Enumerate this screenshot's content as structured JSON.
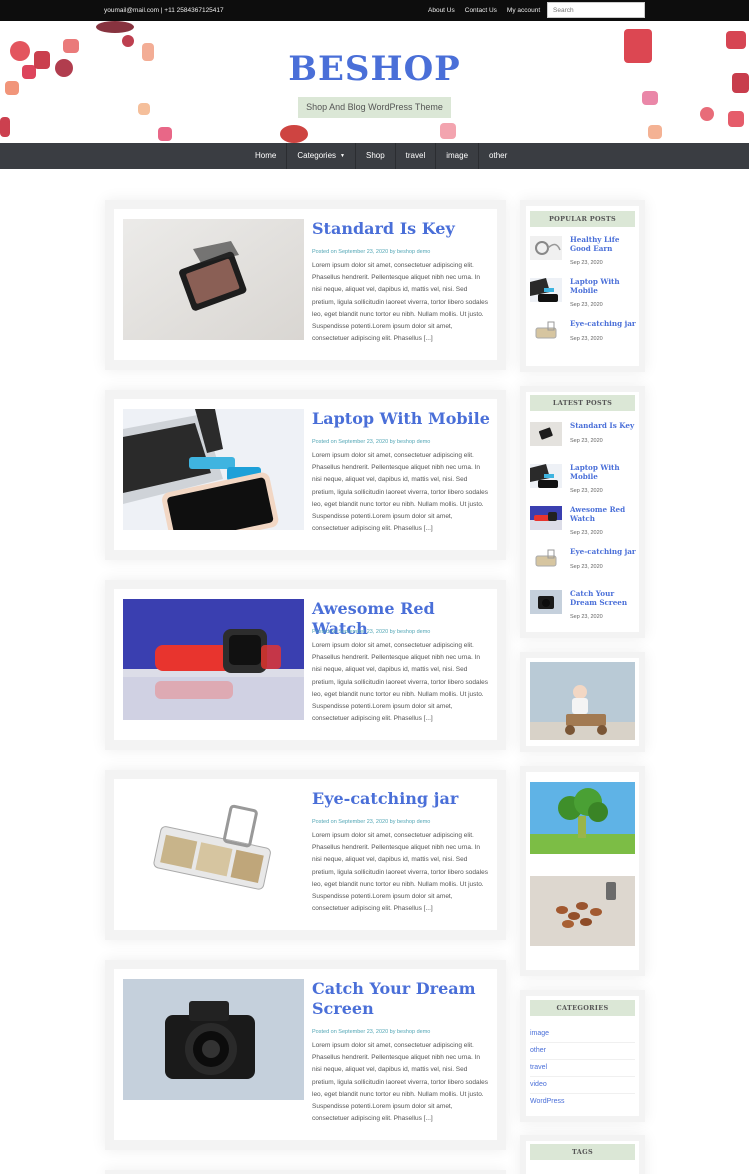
{
  "topbar": {
    "contact": "youmail@mail.com | +11 2584367125417",
    "links": [
      "About Us",
      "Contact Us",
      "My account"
    ],
    "search_placeholder": "Search"
  },
  "header": {
    "site_title": "BESHOP",
    "tagline": "Shop And Blog WordPress Theme"
  },
  "nav": {
    "items": [
      "Home",
      "Categories",
      "Shop",
      "travel",
      "image",
      "other"
    ]
  },
  "posts": [
    {
      "title": "Standard Is Key",
      "meta": "Posted on September 23, 2020 by beshop demo",
      "excerpt": "Lorem ipsum dolor sit amet, consectetuer adipiscing elit. Phasellus hendrerit. Pellentesque aliquet nibh nec urna. In nisi neque, aliquet vel, dapibus id, mattis vel, nisi. Sed pretium, ligula sollicitudin laoreet viverra, tortor libero sodales leo, eget blandit nunc tortor eu nibh. Nullam mollis. Ut justo. Suspendisse potenti.Lorem ipsum dolor sit amet, consectetuer adipiscing elit. Phasellus [...]"
    },
    {
      "title": "Laptop With Mobile",
      "meta": "Posted on September 23, 2020 by beshop demo",
      "excerpt": "Lorem ipsum dolor sit amet, consectetuer adipiscing elit. Phasellus hendrerit. Pellentesque aliquet nibh nec urna. In nisi neque, aliquet vel, dapibus id, mattis vel, nisi. Sed pretium, ligula sollicitudin laoreet viverra, tortor libero sodales leo, eget blandit nunc tortor eu nibh. Nullam mollis. Ut justo. Suspendisse potenti.Lorem ipsum dolor sit amet, consectetuer adipiscing elit. Phasellus [...]"
    },
    {
      "title": "Awesome Red Watch",
      "meta": "Posted on September 23, 2020 by beshop demo",
      "excerpt": "Lorem ipsum dolor sit amet, consectetuer adipiscing elit. Phasellus hendrerit. Pellentesque aliquet nibh nec urna. In nisi neque, aliquet vel, dapibus id, mattis vel, nisi. Sed pretium, ligula sollicitudin laoreet viverra, tortor libero sodales leo, eget blandit nunc tortor eu nibh. Nullam mollis. Ut justo. Suspendisse potenti.Lorem ipsum dolor sit amet, consectetuer adipiscing elit. Phasellus [...]"
    },
    {
      "title": "Eye-catching jar",
      "meta": "Posted on September 23, 2020 by beshop demo",
      "excerpt": "Lorem ipsum dolor sit amet, consectetuer adipiscing elit. Phasellus hendrerit. Pellentesque aliquet nibh nec urna. In nisi neque, aliquet vel, dapibus id, mattis vel, nisi. Sed pretium, ligula sollicitudin laoreet viverra, tortor libero sodales leo, eget blandit nunc tortor eu nibh. Nullam mollis. Ut justo. Suspendisse potenti.Lorem ipsum dolor sit amet, consectetuer adipiscing elit. Phasellus [...]"
    },
    {
      "title": "Catch Your Dream Screen",
      "meta": "Posted on September 23, 2020 by beshop demo",
      "excerpt": "Lorem ipsum dolor sit amet, consectetuer adipiscing elit. Phasellus hendrerit. Pellentesque aliquet nibh nec urna. In nisi neque, aliquet vel, dapibus id, mattis vel, nisi. Sed pretium, ligula sollicitudin laoreet viverra, tortor libero sodales leo, eget blandit nunc tortor eu nibh. Nullam mollis. Ut justo. Suspendisse potenti.Lorem ipsum dolor sit amet, consectetuer adipiscing elit. Phasellus [...]"
    }
  ],
  "sidebar": {
    "popular": {
      "title": "POPULAR POSTS",
      "items": [
        {
          "title": "Healthy Life Good Earn",
          "date": "Sep 23, 2020"
        },
        {
          "title": "Laptop With Mobile",
          "date": "Sep 23, 2020"
        },
        {
          "title": "Eye-catching jar",
          "date": "Sep 23, 2020"
        }
      ]
    },
    "latest": {
      "title": "LATEST POSTS",
      "items": [
        {
          "title": "Standard Is Key",
          "date": "Sep 23, 2020"
        },
        {
          "title": "Laptop With Mobile",
          "date": "Sep 23, 2020"
        },
        {
          "title": "Awesome Red Watch",
          "date": "Sep 23, 2020"
        },
        {
          "title": "Eye-catching jar",
          "date": "Sep 23, 2020"
        },
        {
          "title": "Catch Your Dream Screen",
          "date": "Sep 23, 2020"
        }
      ]
    },
    "categories": {
      "title": "CATEGORIES",
      "items": [
        "image",
        "other",
        "travel",
        "video",
        "WordPress"
      ]
    },
    "tags": {
      "title": "TAGS"
    }
  },
  "colors": {
    "accent": "#4a6fd8",
    "topbar": "#0d0d0d",
    "nav": "#3a3d42",
    "widget_title_bg": "#dbe7d6",
    "meta": "#52a6b5"
  }
}
